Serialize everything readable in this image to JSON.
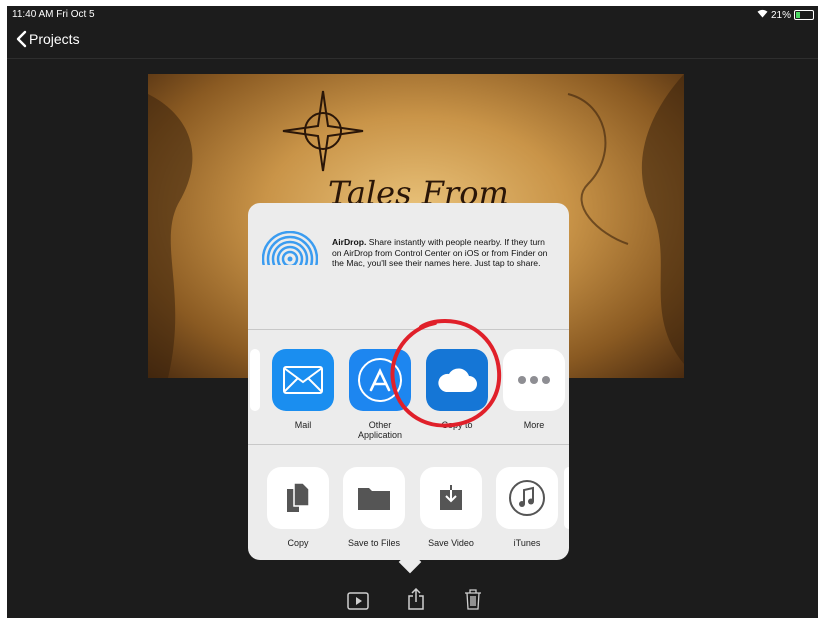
{
  "status_bar": {
    "time": "11:40 AM  Fri Oct 5",
    "battery": "21%"
  },
  "nav": {
    "back_label": "Projects"
  },
  "preview": {
    "title_text": "Tales From"
  },
  "share_sheet": {
    "airdrop": {
      "title": "AirDrop.",
      "text": " Share instantly with people nearby. If they turn on AirDrop from Control Center on iOS or from Finder on the Mac, you'll see their names here. Just tap to share."
    },
    "apps": [
      {
        "label": "Mail",
        "icon": "mail-icon"
      },
      {
        "label": "Other Application",
        "icon": "app-store-icon"
      },
      {
        "label": "Copy to",
        "icon": "icloud-icon"
      },
      {
        "label": "More",
        "icon": "more-icon"
      }
    ],
    "actions": [
      {
        "label": "Copy",
        "icon": "copy-icon"
      },
      {
        "label": "Save to Files",
        "icon": "folder-icon"
      },
      {
        "label": "Save Video",
        "icon": "save-video-icon"
      },
      {
        "label": "iTunes",
        "icon": "itunes-icon"
      }
    ]
  },
  "colors": {
    "annotation": "#e0202a",
    "mail": "#1a8ef0",
    "icloud": "#1576d6",
    "app_store": "#1d86f0"
  }
}
